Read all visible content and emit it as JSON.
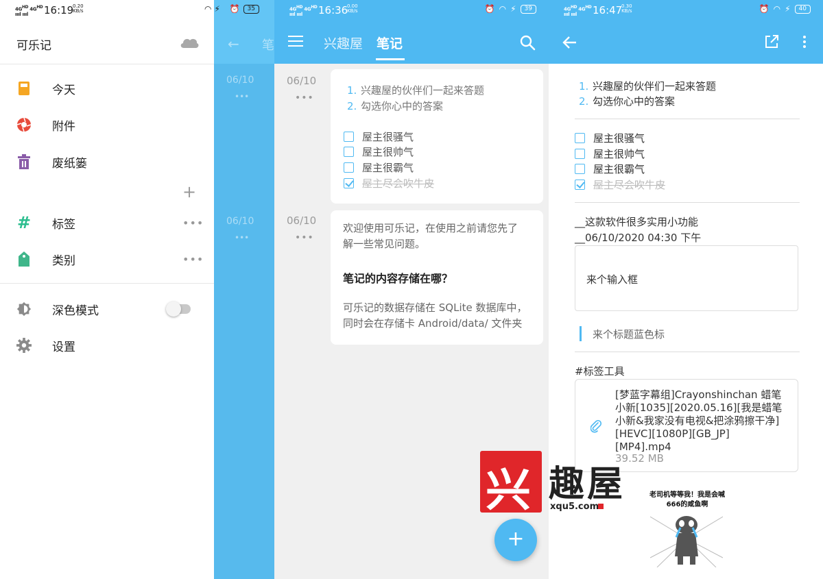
{
  "watermark": {
    "logo_char": "兴",
    "text": "趣屋",
    "url": "xqu5.com",
    "meme_caption": "老司机等等我！我是会喊666的咸鱼啊"
  },
  "phone1": {
    "status": {
      "signal": "4GHD 4GHD",
      "time": "16:19",
      "net_speed": "0.20",
      "net_unit": "KB/s",
      "battery": "35"
    },
    "drawer": {
      "title": "可乐记",
      "items": [
        {
          "label": "今天",
          "icon": "today-icon",
          "color": "#f5a623"
        },
        {
          "label": "附件",
          "icon": "attachment-shutter-icon",
          "color": "#e84b3c"
        },
        {
          "label": "废纸篓",
          "icon": "trash-icon",
          "color": "#8a5ca8"
        }
      ],
      "add_symbol": "+",
      "groups": [
        {
          "label": "标签",
          "icon": "hash-icon",
          "color": "#2bbd8e",
          "more": "•••"
        },
        {
          "label": "类别",
          "icon": "tag-icon",
          "color": "#3fb68a",
          "more": "•••"
        }
      ],
      "settings": [
        {
          "label": "深色模式",
          "icon": "dark-mode-icon",
          "toggle": false
        },
        {
          "label": "设置",
          "icon": "gear-icon"
        }
      ]
    },
    "background_ghost": {
      "tab": "笔",
      "date1": "06/10",
      "date2": "06/10"
    }
  },
  "phone2": {
    "status": {
      "signal": "4GHD 4GHD",
      "time": "16:36",
      "net_speed": "0.00",
      "net_unit": "KB/s",
      "battery": "39"
    },
    "tabs": [
      {
        "label": "兴趣屋",
        "active": false
      },
      {
        "label": "笔记",
        "active": true
      }
    ],
    "notes": [
      {
        "date": "06/10",
        "more": "•••",
        "ordered": [
          {
            "num": "1.",
            "text": "兴趣屋的伙伴们一起来答题"
          },
          {
            "num": "2.",
            "text": "勾选你心中的答案"
          }
        ],
        "checklist": [
          {
            "text": "屋主很骚气",
            "checked": false
          },
          {
            "text": "屋主很帅气",
            "checked": false
          },
          {
            "text": "屋主很霸气",
            "checked": false
          },
          {
            "text": "屋主尽会吹牛皮",
            "checked": true
          }
        ]
      },
      {
        "date": "06/10",
        "more": "•••",
        "intro_line1": "欢迎使用可乐记，在使用之前请您先了",
        "intro_line2": "解一些常见问题。",
        "heading": "笔记的内容存储在哪？",
        "body_line1": "可乐记的数据存储在 SQLite 数据库中，",
        "body_line2": "同时会在存储卡 Android/data/ 文件夹"
      }
    ],
    "fab": "+"
  },
  "phone3": {
    "status": {
      "signal": "4GHD 4GHD",
      "time": "16:47",
      "net_speed": "0.30",
      "net_unit": "KB/s",
      "battery": "40"
    },
    "ordered": [
      {
        "num": "1.",
        "text": "兴趣屋的伙伴们一起来答题"
      },
      {
        "num": "2.",
        "text": "勾选你心中的答案"
      }
    ],
    "checklist": [
      {
        "text": "屋主很骚气",
        "checked": false
      },
      {
        "text": "屋主很帅气",
        "checked": false
      },
      {
        "text": "屋主很霸气",
        "checked": false
      },
      {
        "text": "屋主尽会吹牛皮",
        "checked": true
      }
    ],
    "line1": "__这款软件很多实用小功能",
    "line2": "__06/10/2020 04:30 下午",
    "input_box_text": "来个输入框",
    "quote_text": "来个标题蓝色标",
    "tag_line": "#标签工具",
    "attachment": {
      "name_lines": [
        "[梦蓝字幕组]Crayonshinchan 蜡笔",
        "小新[1035][2020.05.16][我是蜡笔",
        "小新&我家没有电视&把涂鸦擦干净]",
        "[HEVC][1080P][GB_JP]",
        "[MP4].mp4"
      ],
      "size": "39.52 MB"
    }
  }
}
